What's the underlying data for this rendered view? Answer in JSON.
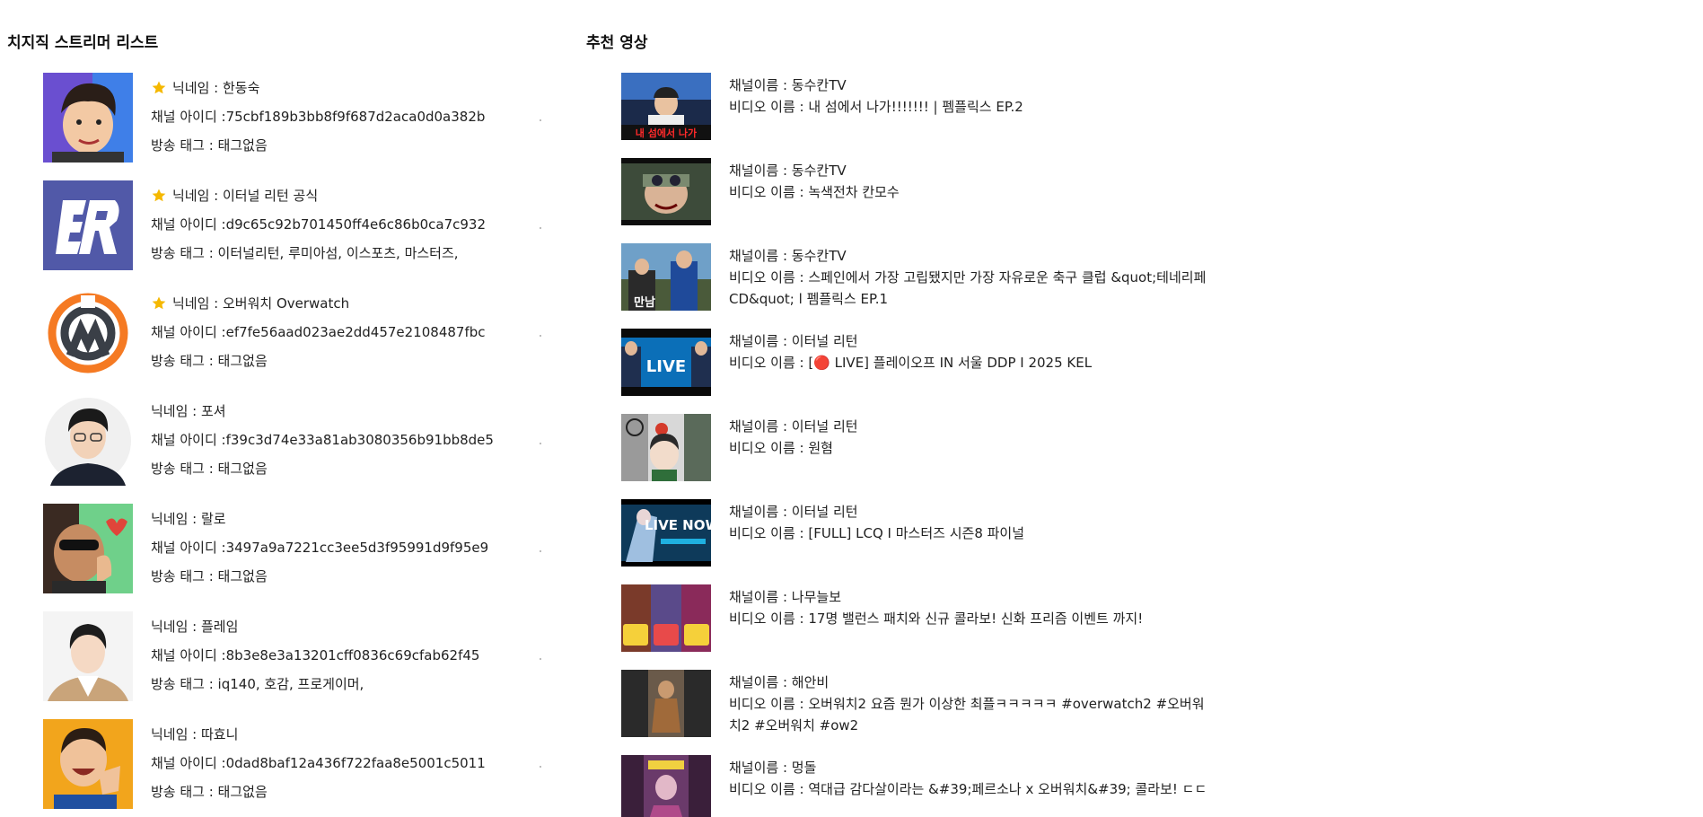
{
  "streamers_section": {
    "title": "치지직 스트리머 리스트",
    "items": [
      {
        "favorite": true,
        "nickname": "닉네임 : 한동숙",
        "channel_id": "채널 아이디 :75cbf189b3bb8f9f687d2aca0d0a382b",
        "tags": "방송 태그 : 태그없음"
      },
      {
        "favorite": true,
        "nickname": "닉네임 : 이터널 리턴 공식",
        "channel_id": "채널 아이디 :d9c65c92b701450ff4e6c86b0ca7c932",
        "tags": "방송 태그 : 이터널리턴,  루미아섬,  이스포츠,  마스터즈,"
      },
      {
        "favorite": true,
        "nickname": "닉네임 : 오버워치 Overwatch",
        "channel_id": "채널 아이디 :ef7fe56aad023ae2dd457e2108487fbc",
        "tags": "방송 태그 : 태그없음"
      },
      {
        "favorite": false,
        "nickname": "닉네임 : 포셔",
        "channel_id": "채널 아이디 :f39c3d74e33a81ab3080356b91bb8de5",
        "tags": "방송 태그 : 태그없음"
      },
      {
        "favorite": false,
        "nickname": "닉네임 : 랄로",
        "channel_id": "채널 아이디 :3497a9a7221cc3ee5d3f95991d9f95e9",
        "tags": "방송 태그 : 태그없음"
      },
      {
        "favorite": false,
        "nickname": "닉네임 : 플레임",
        "channel_id": "채널 아이디 :8b3e8e3a13201cff0836c69cfab62f45",
        "tags": "방송 태그 : iq140,  호감,  프로게이머,"
      },
      {
        "favorite": false,
        "nickname": "닉네임 : 따효니",
        "channel_id": "채널 아이디 :0dad8baf12a436f722faa8e5001c5011",
        "tags": "방송 태그 : 태그없음"
      }
    ]
  },
  "videos_section": {
    "title": "추천 영상",
    "items": [
      {
        "channel": "채널이름 : 동수칸TV",
        "title": "비디오 이름 : 내 섬에서 나가!!!!!!!  | 펨플릭스 EP.2",
        "thumb_text": "내 섬에서 나가"
      },
      {
        "channel": "채널이름 : 동수칸TV",
        "title": "비디오 이름 : 녹색전차 칸모수",
        "thumb_text": ""
      },
      {
        "channel": "채널이름 : 동수칸TV",
        "title": "비디오 이름 : 스페인에서 가장 고립됐지만 가장 자유로운 축구 클럽 &quot;테네리페 CD&quot; l 펨플릭스 EP.1",
        "thumb_text": "만남"
      },
      {
        "channel": "채널이름 : 이터널 리턴",
        "title": "비디오 이름 : [🔴 LIVE] 플레이오프 IN 서울 DDP I 2025 KEL",
        "thumb_text": "LIVE"
      },
      {
        "channel": "채널이름 : 이터널 리턴",
        "title": "비디오 이름 : 원혐",
        "thumb_text": ""
      },
      {
        "channel": "채널이름 : 이터널 리턴",
        "title": "비디오 이름 : [FULL] LCQ I 마스터즈 시즌8 파이널",
        "thumb_text": "LIVE NOW"
      },
      {
        "channel": "채널이름 : 나무늘보",
        "title": "비디오 이름 : 17명 밸런스 패치와 신규 콜라보! 신화 프리즘 이벤트 까지!",
        "thumb_text": ""
      },
      {
        "channel": "채널이름 : 해안비",
        "title": "비디오 이름 : 오버워치2 요즘 뭔가 이상한 최플ㅋㅋㅋㅋㅋ #overwatch2 #오버워치2 #오버워치 #ow2",
        "thumb_text": ""
      },
      {
        "channel": "채널이름 : 멍돌",
        "title": "비디오 이름 : 역대급 감다살이라는 &#39;페르소나 x 오버워치&#39; 콜라보! ㄷㄷ",
        "thumb_text": ""
      }
    ]
  },
  "colors": {
    "favorite_star": "#f5b800",
    "text": "#222222",
    "background": "#ffffff"
  }
}
